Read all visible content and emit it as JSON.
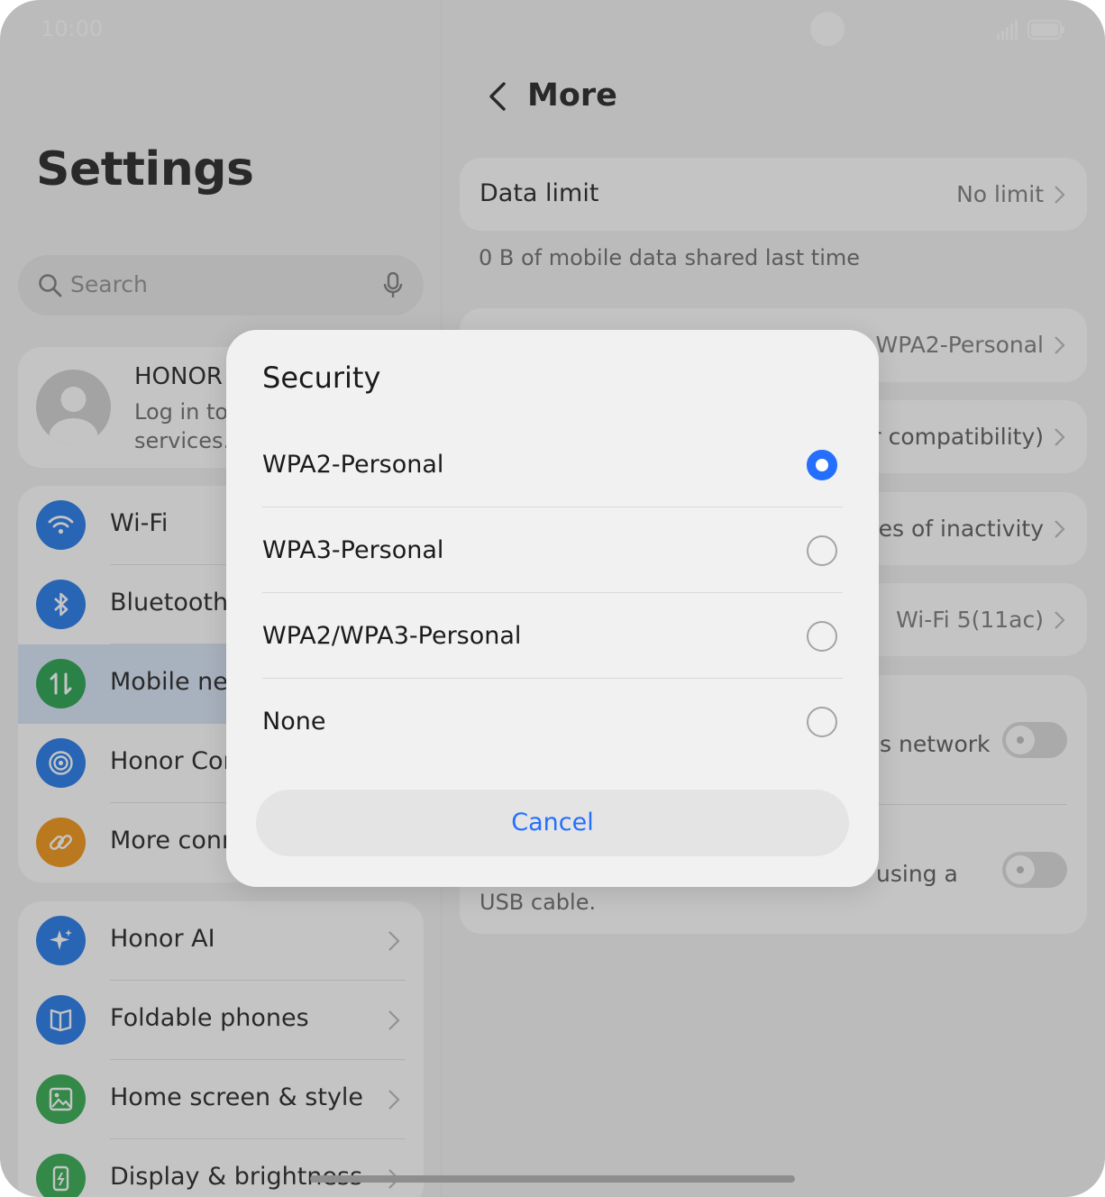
{
  "status_bar": {
    "time": "10:00"
  },
  "left": {
    "title": "Settings",
    "search": {
      "placeholder": "Search"
    },
    "account": {
      "name": "HONOR",
      "subtitle_line1": "Log in to",
      "subtitle_line2": "services."
    },
    "group1": [
      {
        "label": "Wi-Fi",
        "icon": "wifi-icon",
        "color": "#1a73e8"
      },
      {
        "label": "Bluetooth",
        "icon": "bluetooth-icon",
        "color": "#1a73e8"
      },
      {
        "label": "Mobile ne",
        "icon": "mobile-data-icon",
        "color": "#1e9e48"
      },
      {
        "label": "Honor Cor",
        "icon": "connect-icon",
        "color": "#1a73e8"
      },
      {
        "label": "More conr",
        "icon": "link-icon",
        "color": "#f0900c"
      }
    ],
    "group2": [
      {
        "label": "Honor AI",
        "icon": "sparkle-icon",
        "color": "#1a73e8"
      },
      {
        "label": "Foldable phones",
        "icon": "foldable-icon",
        "color": "#1a73e8"
      },
      {
        "label": "Home screen & style",
        "icon": "image-icon",
        "color": "#2ca84a"
      },
      {
        "label": "Display & brightness",
        "icon": "display-icon",
        "color": "#2ca84a"
      }
    ]
  },
  "right": {
    "title": "More",
    "data_limit": {
      "label": "Data limit",
      "value": "No limit"
    },
    "shared_note": "0 B of mobile data shared last time",
    "security_value": "WPA2-Personal",
    "compat_value": "er compatibility)",
    "inactivity_value": "utes of inactivity",
    "band_value": "Wi-Fi 5(11ac)",
    "toggle1_text": "s network",
    "toggle2_text": "using a",
    "toggle2_note": "USB cable."
  },
  "dialog": {
    "title": "Security",
    "options": [
      {
        "label": "WPA2-Personal",
        "selected": true
      },
      {
        "label": "WPA3-Personal",
        "selected": false
      },
      {
        "label": "WPA2/WPA3-Personal",
        "selected": false
      },
      {
        "label": "None",
        "selected": false
      }
    ],
    "cancel": "Cancel"
  },
  "colors": {
    "accent": "#256fff",
    "active_row": "#d6e3f7"
  }
}
